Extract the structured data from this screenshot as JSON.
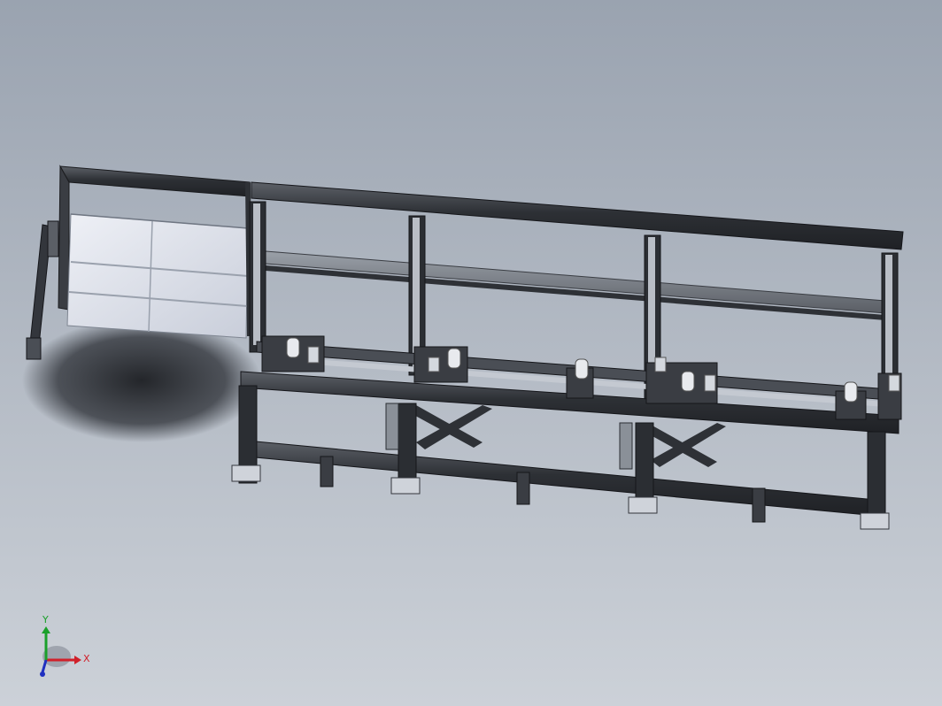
{
  "viewport": {
    "background_top": "#9aa3b0",
    "background_bottom": "#ccd1d8"
  },
  "model": {
    "frame_color": "#2e3136",
    "frame_highlight": "#5a5f66",
    "panel_color": "#dfe3ec",
    "shadow_color": "#2a2d33",
    "roller_color": "#e8eaee"
  },
  "triad": {
    "x_label": "X",
    "y_label": "Y",
    "x_color": "#d0202a",
    "y_color": "#1aa02a",
    "z_color": "#2030c0"
  }
}
